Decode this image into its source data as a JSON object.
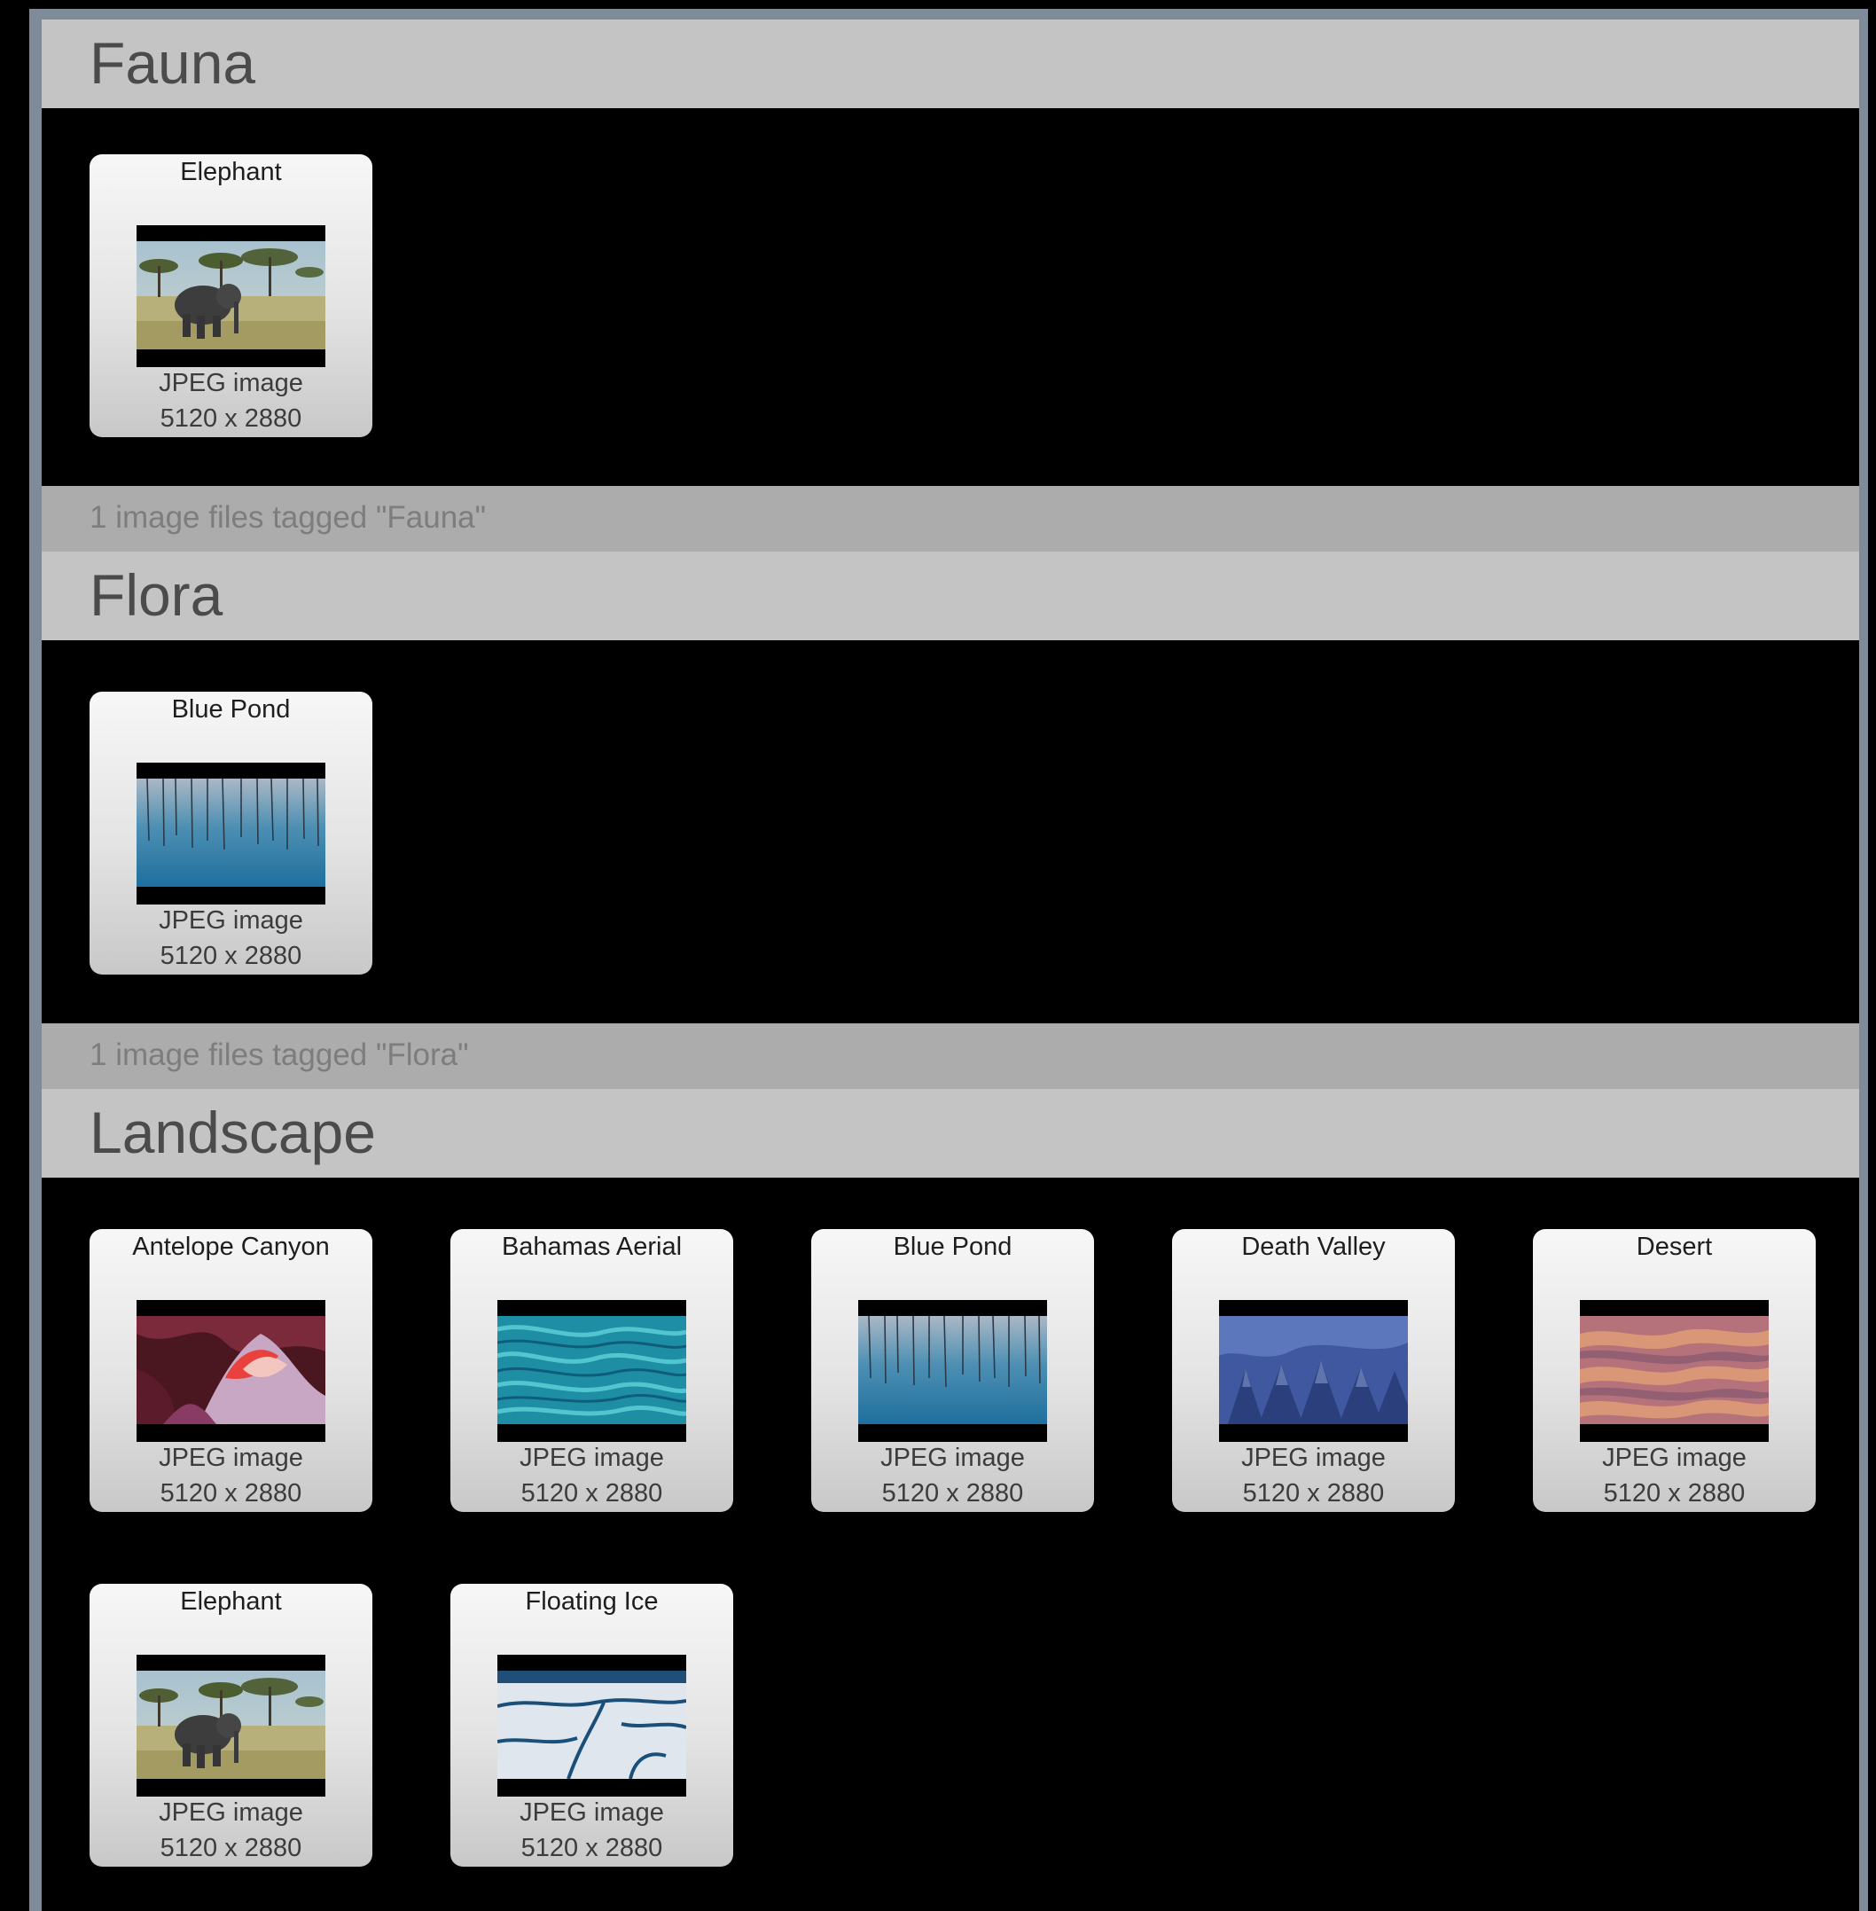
{
  "sections": [
    {
      "title": "Fauna",
      "footer": "1 image files tagged \"Fauna\"",
      "items": [
        {
          "name": "Elephant",
          "kind": "JPEG image",
          "dimensions": "5120 x 2880",
          "thumbnail": "elephant-thumbnail"
        }
      ]
    },
    {
      "title": "Flora",
      "footer": "1 image files tagged \"Flora\"",
      "items": [
        {
          "name": "Blue Pond",
          "kind": "JPEG image",
          "dimensions": "5120 x 2880",
          "thumbnail": "blue-pond-thumbnail"
        }
      ]
    },
    {
      "title": "Landscape",
      "items": [
        {
          "name": "Antelope Canyon",
          "kind": "JPEG image",
          "dimensions": "5120 x 2880",
          "thumbnail": "antelope-canyon-thumbnail"
        },
        {
          "name": "Bahamas Aerial",
          "kind": "JPEG image",
          "dimensions": "5120 x 2880",
          "thumbnail": "bahamas-aerial-thumbnail"
        },
        {
          "name": "Blue Pond",
          "kind": "JPEG image",
          "dimensions": "5120 x 2880",
          "thumbnail": "blue-pond-thumbnail"
        },
        {
          "name": "Death Valley",
          "kind": "JPEG image",
          "dimensions": "5120 x 2880",
          "thumbnail": "death-valley-thumbnail"
        },
        {
          "name": "Desert",
          "kind": "JPEG image",
          "dimensions": "5120 x 2880",
          "thumbnail": "desert-thumbnail"
        },
        {
          "name": "Elephant",
          "kind": "JPEG image",
          "dimensions": "5120 x 2880",
          "thumbnail": "elephant-thumbnail"
        },
        {
          "name": "Floating Ice",
          "kind": "JPEG image",
          "dimensions": "5120 x 2880",
          "thumbnail": "floating-ice-thumbnail"
        }
      ]
    }
  ],
  "colors": {
    "header_bg": "#c4c4c4",
    "footer_bg": "#acacac",
    "window_frame": "#7f8b98",
    "content_bg": "#000000"
  }
}
